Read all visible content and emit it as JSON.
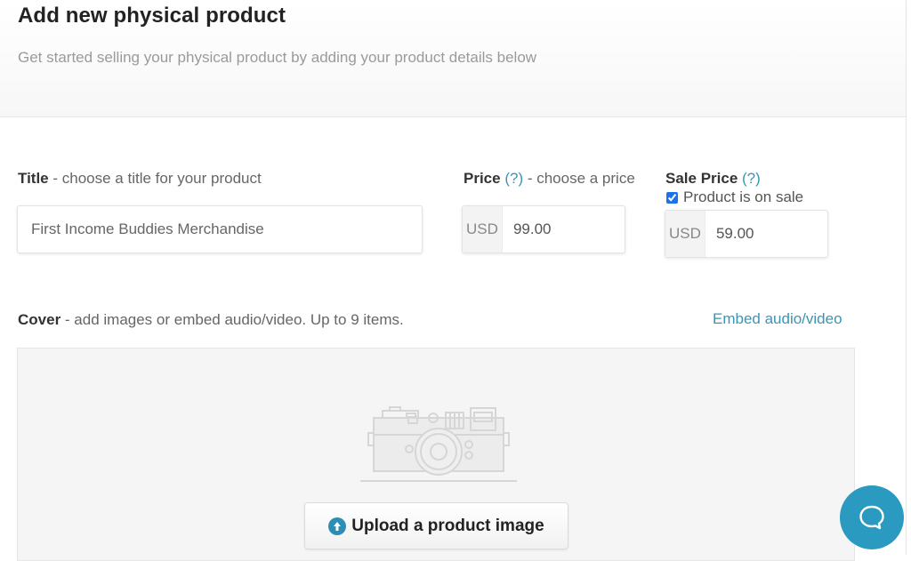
{
  "header": {
    "title": "Add new physical product",
    "subtitle": "Get started selling your physical product by adding your product details below"
  },
  "title_field": {
    "label_bold": "Title",
    "label_rest": " - choose a title for your product",
    "value": "First Income Buddies Merchandise"
  },
  "price_field": {
    "label_bold": "Price",
    "help": "(?)",
    "label_rest": " - choose a price",
    "currency": "USD",
    "value": "99.00"
  },
  "sale_price_field": {
    "label_bold": "Sale Price",
    "help": "(?)",
    "checkbox_label": "Product is on sale",
    "checkbox_checked": true,
    "currency": "USD",
    "value": "59.00"
  },
  "cover": {
    "label_bold": "Cover",
    "label_rest": " - add images or embed audio/video. Up to 9 items.",
    "embed_link": "Embed audio/video",
    "upload_button": "Upload a product image",
    "placeholder_icon": "camera-icon"
  },
  "chat": {
    "icon": "chat-bubble-icon"
  },
  "colors": {
    "accent": "#3b95b5",
    "chat_button": "#2a9ac0",
    "upload_icon": "#2e8db5"
  }
}
